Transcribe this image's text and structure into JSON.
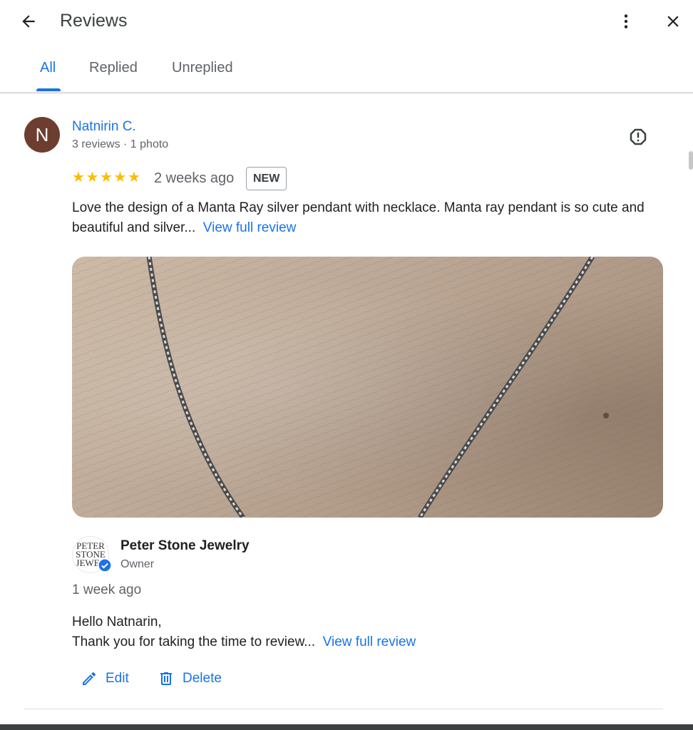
{
  "header": {
    "title": "Reviews",
    "back_icon": "arrow-left-icon",
    "more_icon": "more-vert-icon",
    "close_icon": "close-icon"
  },
  "tabs": [
    {
      "label": "All",
      "active": true
    },
    {
      "label": "Replied",
      "active": false
    },
    {
      "label": "Unreplied",
      "active": false
    }
  ],
  "review": {
    "avatar_letter": "N",
    "avatar_color": "#6d3e2f",
    "name": "Natnirin C.",
    "meta": "3 reviews · 1 photo",
    "rating": 5,
    "time_ago": "2 weeks ago",
    "badge": "NEW",
    "text": "Love the design of a Manta Ray silver pendant with necklace. Manta ray pendant is so cute and beautiful and silver...",
    "view_full": "View full review",
    "report_icon": "report-icon"
  },
  "owner_reply": {
    "logo_lines": [
      "PETER",
      "STONE",
      "JEWEL"
    ],
    "name": "Peter Stone Jewelry",
    "role": "Owner",
    "time_ago": "1 week ago",
    "greeting": "Hello Natnarin,",
    "text": "Thank you for taking the time to review...",
    "view_full": "View full review",
    "edit_label": "Edit",
    "delete_label": "Delete"
  },
  "colors": {
    "accent": "#1a73e8",
    "star": "#fbbc04",
    "text": "#202124",
    "muted": "#5f6368"
  }
}
